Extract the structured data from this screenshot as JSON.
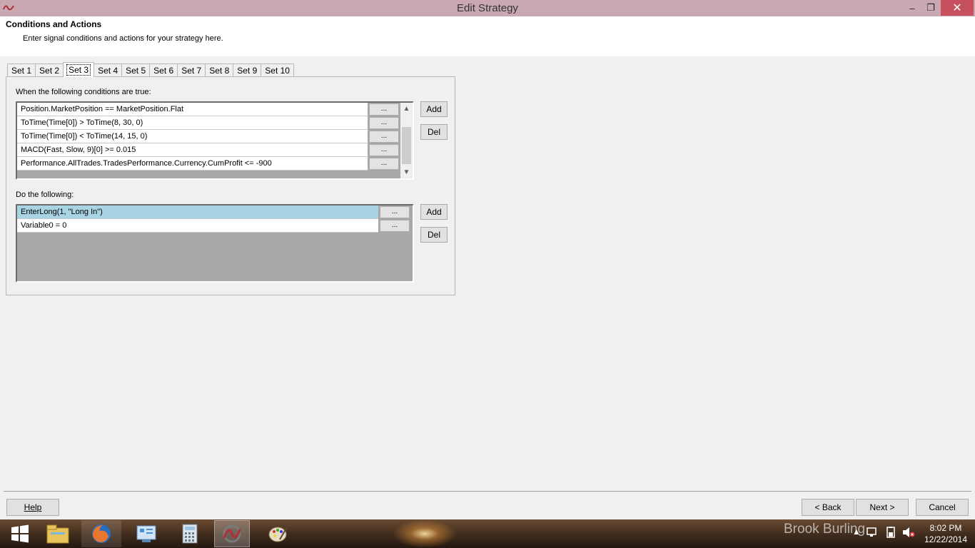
{
  "window": {
    "title": "Edit Strategy",
    "minimize": "–",
    "maximize": "❐",
    "close": "✕"
  },
  "header": {
    "title": "Conditions and Actions",
    "subtitle": "Enter signal conditions and actions for your strategy here."
  },
  "tabs": [
    "Set 1",
    "Set 2",
    "Set 3",
    "Set 4",
    "Set 5",
    "Set 6",
    "Set 7",
    "Set 8",
    "Set 9",
    "Set 10"
  ],
  "active_tab": "Set 3",
  "conditions": {
    "label": "When the following conditions are true:",
    "rows": [
      "Position.MarketPosition == MarketPosition.Flat",
      "ToTime(Time[0]) > ToTime(8, 30, 0)",
      "ToTime(Time[0]) < ToTime(14, 15, 0)",
      "MACD(Fast, Slow, 9)[0] >= 0.015",
      "Performance.AllTrades.TradesPerformance.Currency.CumProfit <= -900"
    ],
    "row_button": "...",
    "add": "Add",
    "del": "Del"
  },
  "actions": {
    "label": "Do the following:",
    "rows": [
      "EnterLong(1, \"Long In\")",
      "Variable0 = 0"
    ],
    "selected_row": 0,
    "row_button": "...",
    "add": "Add",
    "del": "Del"
  },
  "footer": {
    "help": "Help",
    "back": "< Back",
    "next": "Next >",
    "cancel": "Cancel"
  },
  "taskbar": {
    "items": [
      "start-icon",
      "file-explorer-icon",
      "firefox-icon",
      "control-panel-icon",
      "calculator-icon",
      "ninjatrader-icon",
      "paint-icon"
    ],
    "watermark": "Brook Burling",
    "time": "8:02 PM",
    "date": "12/22/2014"
  },
  "colors": {
    "titlebar": "#c9a8b2",
    "close": "#c7505f",
    "selected_row": "#a9d4e4",
    "grid_bg": "#a8a8a8"
  }
}
